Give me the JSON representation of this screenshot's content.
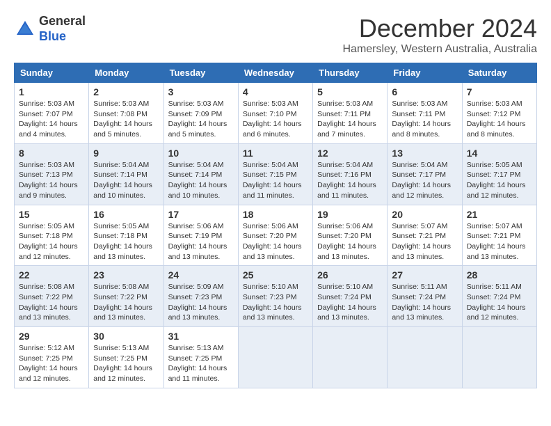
{
  "header": {
    "logo_general": "General",
    "logo_blue": "Blue",
    "title": "December 2024",
    "subtitle": "Hamersley, Western Australia, Australia"
  },
  "calendar": {
    "days_of_week": [
      "Sunday",
      "Monday",
      "Tuesday",
      "Wednesday",
      "Thursday",
      "Friday",
      "Saturday"
    ],
    "weeks": [
      [
        {
          "day": "",
          "info": ""
        },
        {
          "day": "2",
          "info": "Sunrise: 5:03 AM\nSunset: 7:08 PM\nDaylight: 14 hours\nand 5 minutes."
        },
        {
          "day": "3",
          "info": "Sunrise: 5:03 AM\nSunset: 7:09 PM\nDaylight: 14 hours\nand 5 minutes."
        },
        {
          "day": "4",
          "info": "Sunrise: 5:03 AM\nSunset: 7:10 PM\nDaylight: 14 hours\nand 6 minutes."
        },
        {
          "day": "5",
          "info": "Sunrise: 5:03 AM\nSunset: 7:11 PM\nDaylight: 14 hours\nand 7 minutes."
        },
        {
          "day": "6",
          "info": "Sunrise: 5:03 AM\nSunset: 7:11 PM\nDaylight: 14 hours\nand 8 minutes."
        },
        {
          "day": "7",
          "info": "Sunrise: 5:03 AM\nSunset: 7:12 PM\nDaylight: 14 hours\nand 8 minutes."
        }
      ],
      [
        {
          "day": "1",
          "info": "Sunrise: 5:03 AM\nSunset: 7:07 PM\nDaylight: 14 hours\nand 4 minutes."
        },
        {
          "day": "",
          "info": ""
        },
        {
          "day": "",
          "info": ""
        },
        {
          "day": "",
          "info": ""
        },
        {
          "day": "",
          "info": ""
        },
        {
          "day": "",
          "info": ""
        },
        {
          "day": "",
          "info": ""
        }
      ],
      [
        {
          "day": "8",
          "info": "Sunrise: 5:03 AM\nSunset: 7:13 PM\nDaylight: 14 hours\nand 9 minutes."
        },
        {
          "day": "9",
          "info": "Sunrise: 5:04 AM\nSunset: 7:14 PM\nDaylight: 14 hours\nand 10 minutes."
        },
        {
          "day": "10",
          "info": "Sunrise: 5:04 AM\nSunset: 7:14 PM\nDaylight: 14 hours\nand 10 minutes."
        },
        {
          "day": "11",
          "info": "Sunrise: 5:04 AM\nSunset: 7:15 PM\nDaylight: 14 hours\nand 11 minutes."
        },
        {
          "day": "12",
          "info": "Sunrise: 5:04 AM\nSunset: 7:16 PM\nDaylight: 14 hours\nand 11 minutes."
        },
        {
          "day": "13",
          "info": "Sunrise: 5:04 AM\nSunset: 7:17 PM\nDaylight: 14 hours\nand 12 minutes."
        },
        {
          "day": "14",
          "info": "Sunrise: 5:05 AM\nSunset: 7:17 PM\nDaylight: 14 hours\nand 12 minutes."
        }
      ],
      [
        {
          "day": "15",
          "info": "Sunrise: 5:05 AM\nSunset: 7:18 PM\nDaylight: 14 hours\nand 12 minutes."
        },
        {
          "day": "16",
          "info": "Sunrise: 5:05 AM\nSunset: 7:18 PM\nDaylight: 14 hours\nand 13 minutes."
        },
        {
          "day": "17",
          "info": "Sunrise: 5:06 AM\nSunset: 7:19 PM\nDaylight: 14 hours\nand 13 minutes."
        },
        {
          "day": "18",
          "info": "Sunrise: 5:06 AM\nSunset: 7:20 PM\nDaylight: 14 hours\nand 13 minutes."
        },
        {
          "day": "19",
          "info": "Sunrise: 5:06 AM\nSunset: 7:20 PM\nDaylight: 14 hours\nand 13 minutes."
        },
        {
          "day": "20",
          "info": "Sunrise: 5:07 AM\nSunset: 7:21 PM\nDaylight: 14 hours\nand 13 minutes."
        },
        {
          "day": "21",
          "info": "Sunrise: 5:07 AM\nSunset: 7:21 PM\nDaylight: 14 hours\nand 13 minutes."
        }
      ],
      [
        {
          "day": "22",
          "info": "Sunrise: 5:08 AM\nSunset: 7:22 PM\nDaylight: 14 hours\nand 13 minutes."
        },
        {
          "day": "23",
          "info": "Sunrise: 5:08 AM\nSunset: 7:22 PM\nDaylight: 14 hours\nand 13 minutes."
        },
        {
          "day": "24",
          "info": "Sunrise: 5:09 AM\nSunset: 7:23 PM\nDaylight: 14 hours\nand 13 minutes."
        },
        {
          "day": "25",
          "info": "Sunrise: 5:10 AM\nSunset: 7:23 PM\nDaylight: 14 hours\nand 13 minutes."
        },
        {
          "day": "26",
          "info": "Sunrise: 5:10 AM\nSunset: 7:24 PM\nDaylight: 14 hours\nand 13 minutes."
        },
        {
          "day": "27",
          "info": "Sunrise: 5:11 AM\nSunset: 7:24 PM\nDaylight: 14 hours\nand 13 minutes."
        },
        {
          "day": "28",
          "info": "Sunrise: 5:11 AM\nSunset: 7:24 PM\nDaylight: 14 hours\nand 12 minutes."
        }
      ],
      [
        {
          "day": "29",
          "info": "Sunrise: 5:12 AM\nSunset: 7:25 PM\nDaylight: 14 hours\nand 12 minutes."
        },
        {
          "day": "30",
          "info": "Sunrise: 5:13 AM\nSunset: 7:25 PM\nDaylight: 14 hours\nand 12 minutes."
        },
        {
          "day": "31",
          "info": "Sunrise: 5:13 AM\nSunset: 7:25 PM\nDaylight: 14 hours\nand 11 minutes."
        },
        {
          "day": "",
          "info": ""
        },
        {
          "day": "",
          "info": ""
        },
        {
          "day": "",
          "info": ""
        },
        {
          "day": "",
          "info": ""
        }
      ]
    ]
  }
}
